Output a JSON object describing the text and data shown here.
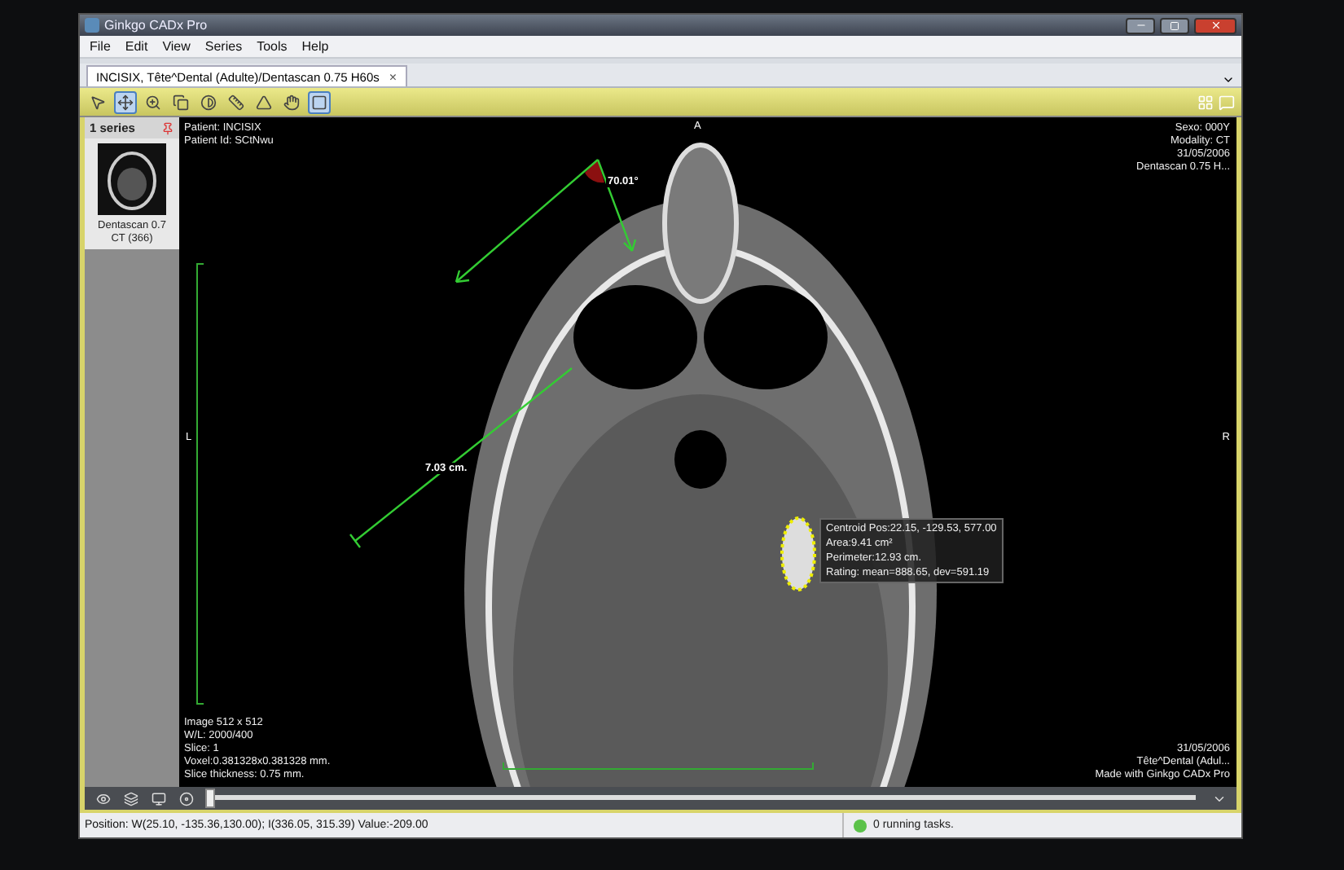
{
  "window": {
    "title": "Ginkgo CADx Pro"
  },
  "menu": [
    "File",
    "Edit",
    "View",
    "Series",
    "Tools",
    "Help"
  ],
  "tabs": [
    {
      "label": "INCISIX, Tête^Dental (Adulte)/Dentascan  0.75  H60s",
      "close": "×",
      "selected": true
    }
  ],
  "tools": [
    {
      "selected": false
    },
    {
      "selected": true
    },
    {
      "selected": false
    },
    {
      "selected": false
    },
    {
      "selected": false
    },
    {
      "selected": false
    },
    {
      "selected": false
    },
    {
      "selected": false
    },
    {
      "selected": true
    }
  ],
  "series_panel": {
    "header": "1 series",
    "items": [
      {
        "name": "Dentascan  0.7",
        "detail": "CT (366)",
        "selected": true
      }
    ]
  },
  "viewer": {
    "top_left": [
      "Patient: INCISIX",
      "Patient Id: SCtNwu"
    ],
    "top_right": [
      "Sexo: 000Y",
      "Modality: CT",
      "31/05/2006",
      "Dentascan 0.75 H..."
    ],
    "bottom_left": [
      "Image 512 x 512",
      "W/L: 2000/400",
      "Slice: 1",
      "Voxel:0.381328x0.381328 mm.",
      "Slice thickness: 0.75 mm."
    ],
    "bottom_right": [
      "31/05/2006",
      "Tête^Dental (Adul...",
      "Made with Ginkgo CADx Pro"
    ],
    "orientation": {
      "top": "A",
      "left": "L",
      "right": "R"
    },
    "angle_label": "70.01°",
    "distance_label": "7.03 cm.",
    "roi_info": [
      "Centroid Pos:22.15, -129.53, 577.00",
      "Area:9.41 cm²",
      "Perimeter:12.93 cm.",
      "Rating: mean=888.65, dev=591.19"
    ]
  },
  "slice_slider": {
    "level": 0
  },
  "status_bar": {
    "position": "Position: W(25.10, -135.36,130.00); I(336.05, 315.39) Value:-209.00",
    "tasks": "0 running tasks."
  }
}
